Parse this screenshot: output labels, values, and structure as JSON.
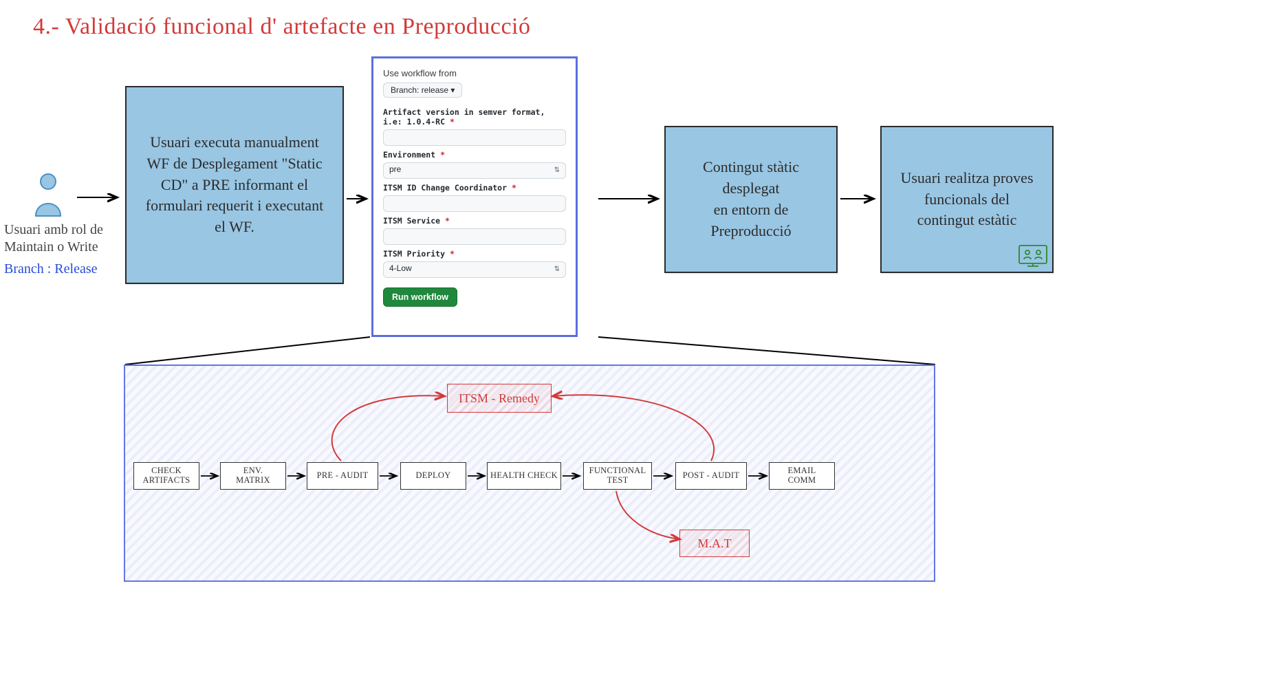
{
  "title": "4.- Validació funcional d' artefacte en Preproducció",
  "user": {
    "caption": "Usuari amb rol de\nMaintain o Write",
    "branch": "Branch : Release"
  },
  "box1": "Usuari executa manualment WF de Desplegament \"Static CD\" a PRE informant el formulari requerit i executant el WF.",
  "box3": "Contingut stàtic desplegat\nen entorn de Preproducció",
  "box4": "Usuari realitza proves funcionals del contingut estàtic",
  "workflow": {
    "use_from": "Use workflow from",
    "branch": "Branch: release ▾",
    "artifact_label": "Artifact version in semver format, i.e: 1.0.4-RC",
    "artifact_value": "",
    "env_label": "Environment",
    "env_value": "pre",
    "itsm_coord_label": "ITSM ID Change Coordinator",
    "itsm_coord_value": "",
    "itsm_service_label": "ITSM Service",
    "itsm_service_value": "",
    "itsm_priority_label": "ITSM Priority",
    "itsm_priority_value": "4-Low",
    "run": "Run workflow"
  },
  "panel": {
    "itsm": "ITSM - Remedy",
    "mat": "M.A.T",
    "steps": [
      "CHECK\nARTIFACTS",
      "ENV.\nMATRIX",
      "PRE - AUDIT",
      "DEPLOY",
      "HEALTH CHECK",
      "FUNCTIONAL\nTEST",
      "POST - AUDIT",
      "EMAIL\nCOMM"
    ]
  }
}
